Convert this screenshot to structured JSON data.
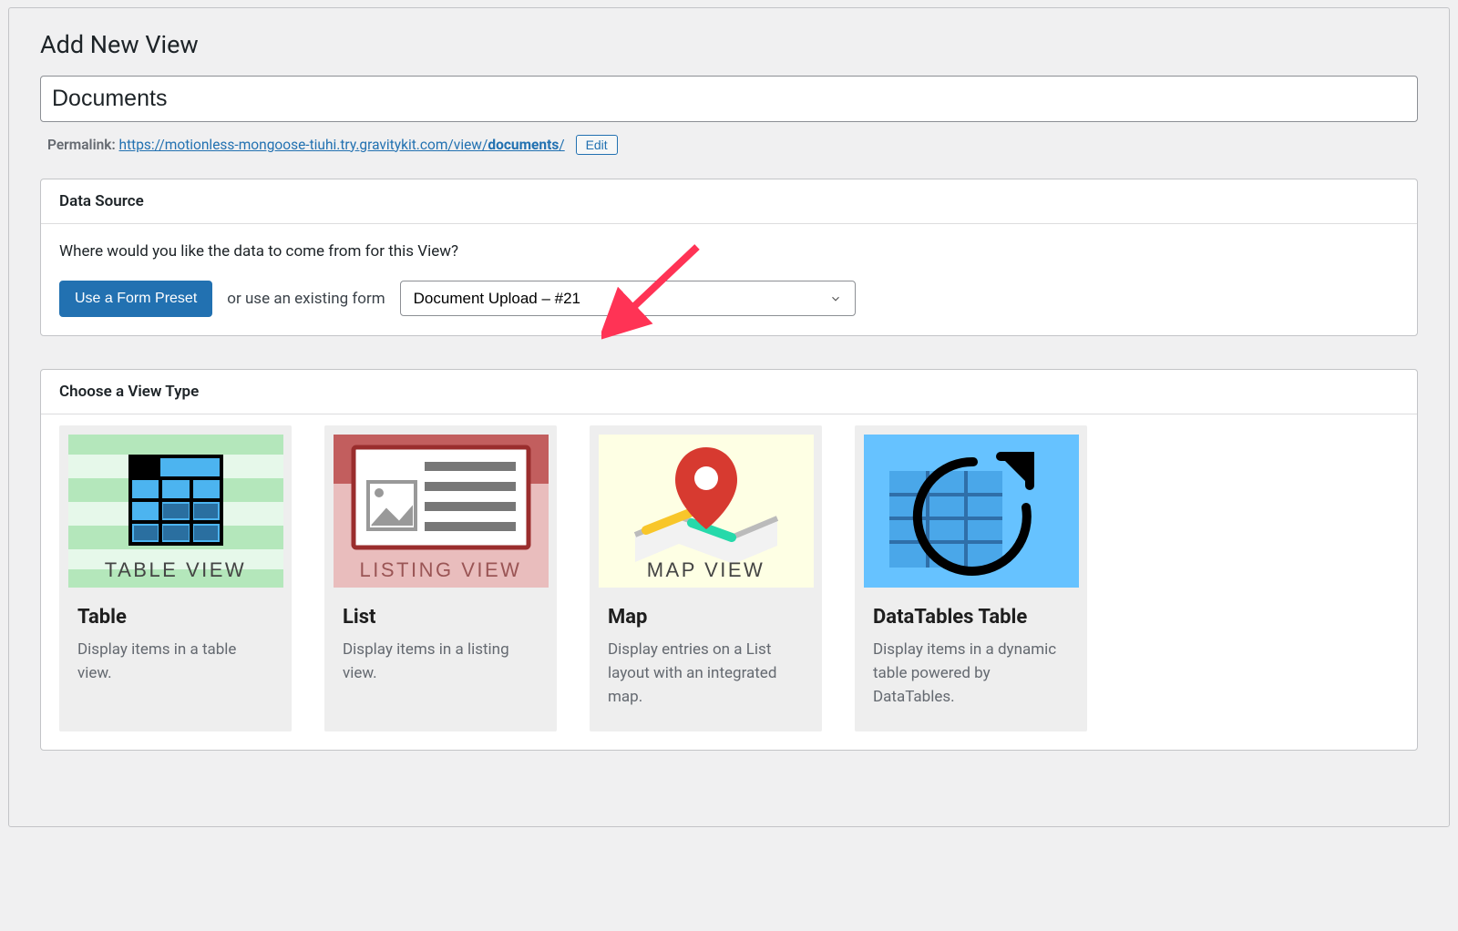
{
  "header": {
    "title": "Add New View"
  },
  "form": {
    "title_value": "Documents",
    "permalink_label": "Permalink:",
    "permalink_url_prefix": "https://motionless-mongoose-tiuhi.try.gravitykit.com/view/",
    "permalink_slug": "documents",
    "permalink_trail": "/",
    "edit_btn": "Edit"
  },
  "data_source": {
    "box_title": "Data Source",
    "prompt": "Where would you like the data to come from for this View?",
    "preset_btn": "Use a Form Preset",
    "or_label": "or use an existing form",
    "selected_form": "Document Upload – #21"
  },
  "view_type": {
    "box_title": "Choose a View Type",
    "items": [
      {
        "title": "Table",
        "desc": "Display items in a table view.",
        "caption": "TABLE VIEW"
      },
      {
        "title": "List",
        "desc": "Display items in a listing view.",
        "caption": "LISTING VIEW"
      },
      {
        "title": "Map",
        "desc": "Display entries on a List layout with an integrated map.",
        "caption": "MAP VIEW"
      },
      {
        "title": "DataTables Table",
        "desc": "Display items in a dynamic table powered by DataTables.",
        "caption": ""
      }
    ]
  }
}
